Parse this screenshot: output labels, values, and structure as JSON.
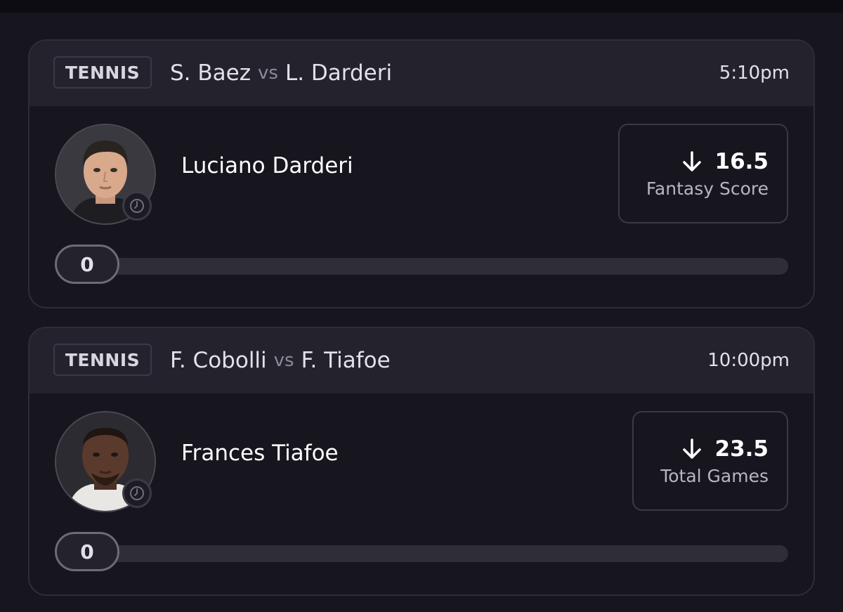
{
  "picks": [
    {
      "sport": "TENNIS",
      "matchup": {
        "team_a": "S. Baez",
        "vs": "vs",
        "team_b": "L. Darderi"
      },
      "time": "5:10pm",
      "player": {
        "name": "Luciano Darderi",
        "avatar": "player-photo",
        "status_icon": "clock-icon"
      },
      "stat": {
        "direction": "down",
        "direction_icon": "arrow-down-icon",
        "value": "16.5",
        "label": "Fantasy Score"
      },
      "progress": {
        "current": "0",
        "fill": 0
      }
    },
    {
      "sport": "TENNIS",
      "matchup": {
        "team_a": "F. Cobolli",
        "vs": "vs",
        "team_b": "F. Tiafoe"
      },
      "time": "10:00pm",
      "player": {
        "name": "Frances Tiafoe",
        "avatar": "player-photo",
        "status_icon": "clock-icon"
      },
      "stat": {
        "direction": "down",
        "direction_icon": "arrow-down-icon",
        "value": "23.5",
        "label": "Total Games"
      },
      "progress": {
        "current": "0",
        "fill": 0
      }
    }
  ],
  "colors": {
    "background": "#17161f",
    "header": "#24232d",
    "border": "#2e2d38",
    "text": "#ffffff",
    "muted": "#8b8a96"
  }
}
